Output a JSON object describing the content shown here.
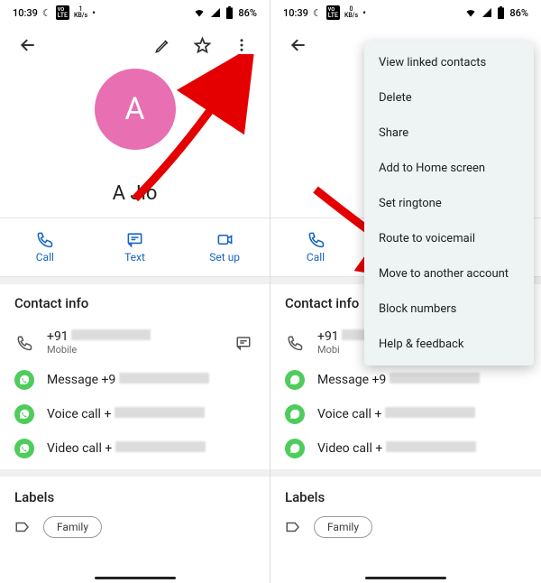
{
  "status": {
    "time": "10:39",
    "net": "1",
    "kbps": "KB/s",
    "battery": "86%"
  },
  "contact": {
    "initial": "A",
    "name": "A Jio"
  },
  "actions": {
    "call": "Call",
    "text": "Text",
    "setup": "Set up"
  },
  "section_info": {
    "title": "Contact info",
    "phone_prefix": "+91",
    "phone_type": "Mobile",
    "wa_msg": "Message +9",
    "wa_voice": "Voice call +",
    "wa_video": "Video call +"
  },
  "labels": {
    "title": "Labels",
    "chip": "Family"
  },
  "menu": {
    "items": [
      "View linked contacts",
      "Delete",
      "Share",
      "Add to Home screen",
      "Set ringtone",
      "Route to voicemail",
      "Move to another account",
      "Block numbers",
      "Help & feedback"
    ]
  }
}
